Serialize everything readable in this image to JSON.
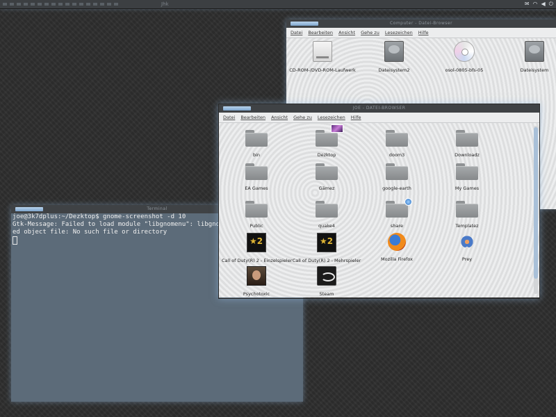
{
  "top_panel": {
    "center_text": "Jhk",
    "tray_icons": [
      "email-icon",
      "wifi-icon",
      "volume-icon",
      "power-icon"
    ]
  },
  "back_window": {
    "title": "Computer - Datei-Browser",
    "menu": [
      "Datei",
      "Bearbeiten",
      "Ansicht",
      "Gehe zu",
      "Lesezeichen",
      "Hilfe"
    ],
    "items": [
      {
        "label": "CD-ROM-/DVD-ROM-Laufwerk",
        "icon": "optical-drive-icon"
      },
      {
        "label": "Dateisystem2",
        "icon": "harddisk-icon"
      },
      {
        "label": "osol-0805-bfs-05",
        "icon": "cd-icon"
      },
      {
        "label": "Dateisystem",
        "icon": "harddisk-icon"
      }
    ]
  },
  "front_window": {
    "title": "JOE - DATEI-BROWSER",
    "menu": [
      "Datei",
      "Bearbeiten",
      "Ansicht",
      "Gehe zu",
      "Lesezeichen",
      "Hilfe"
    ],
    "items": [
      {
        "label": "bin",
        "icon": "folder-icon"
      },
      {
        "label": "Dezktop",
        "icon": "folder-icon"
      },
      {
        "label": "doom3",
        "icon": "folder-icon"
      },
      {
        "label": "Downloadz",
        "icon": "folder-icon"
      },
      {
        "label": "EA Games",
        "icon": "folder-icon"
      },
      {
        "label": "Gämez",
        "icon": "folder-icon"
      },
      {
        "label": "google-earth",
        "icon": "folder-icon"
      },
      {
        "label": "My Games",
        "icon": "folder-icon"
      },
      {
        "label": "Public",
        "icon": "folder-icon"
      },
      {
        "label": "quake4",
        "icon": "folder-icon"
      },
      {
        "label": "share",
        "icon": "folder-icon"
      },
      {
        "label": "Templatez",
        "icon": "folder-icon"
      },
      {
        "label": "Call of Duty(R) 2 - Einzelspieler",
        "icon": "cod2-icon"
      },
      {
        "label": "Call of Duty(R) 2 - Mehrspieler",
        "icon": "cod2-icon"
      },
      {
        "label": "Mozilla Firefox",
        "icon": "firefox-icon"
      },
      {
        "label": "Prey",
        "icon": "prey-icon"
      },
      {
        "label": "Psychotoxic",
        "icon": "psychotoxic-icon"
      },
      {
        "label": "Steam",
        "icon": "steam-icon"
      }
    ]
  },
  "terminal": {
    "title": "Terminal",
    "lines": [
      "joe@3k7dplus:~/Dezktop$ gnome-screenshot -d 10",
      "Gtk-Message: Failed to load module \"libgnomenu\": libgnome",
      "ed object file: No such file or directory"
    ]
  }
}
